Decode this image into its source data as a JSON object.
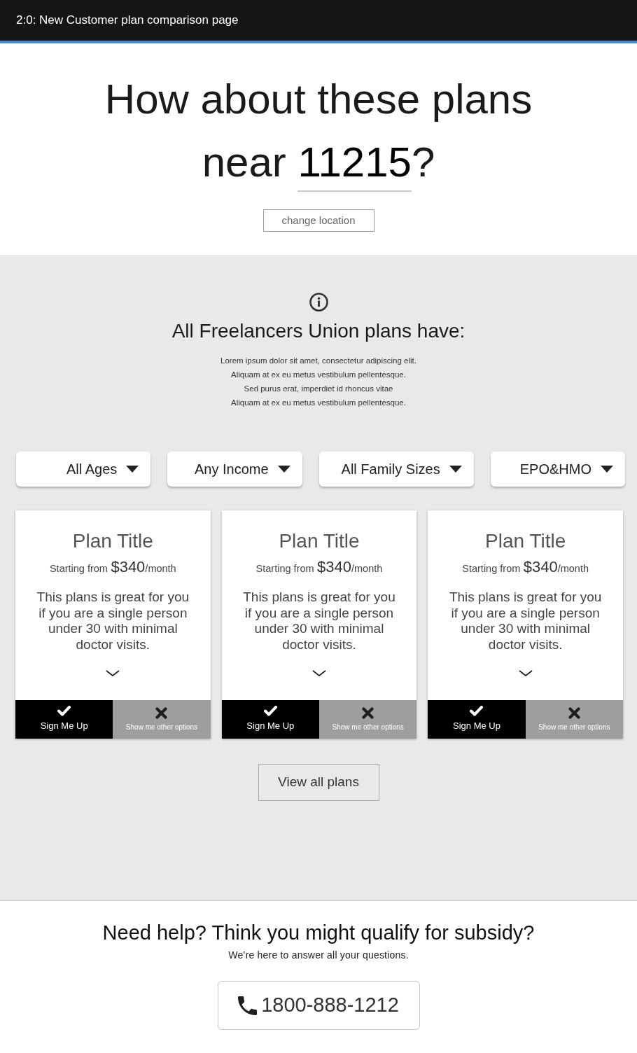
{
  "window": {
    "title": "2:0: New Customer plan comparison page"
  },
  "hero": {
    "heading": "How about these plans near **11215**?",
    "button": "change location"
  },
  "info": {
    "title": "All Freelancers Union plans have:",
    "lines": [
      "Lorem ipsum dolor sit amet, consectetur adipiscing elit.",
      "Aliquam at ex eu metus vestibulum pellentesque.",
      "Sed purus erat, imperdiet id rhoncus vitae",
      "Aliquam at ex eu metus vestibulum pellentesque."
    ]
  },
  "filters": [
    {
      "label": "All Ages"
    },
    {
      "label": "Any Income"
    },
    {
      "label": "All Family Sizes"
    },
    {
      "label": "EPO&HMO"
    }
  ],
  "plans": [
    {
      "title": "Plan Title",
      "price_label": "Starting from",
      "price": "$340",
      "price_period": "/month",
      "description": "This plans is great for you if you are a single person under 30 with minimal doctor visits.",
      "actions": [
        {
          "kind": "accept",
          "label": "Sign Me Up"
        },
        {
          "kind": "decline",
          "label": "Show me other options"
        }
      ]
    },
    {
      "title": "Plan Title",
      "price_label": "Starting from",
      "price": "$340",
      "price_period": "/month",
      "description": "This plans is great for you if you are a single person under 30 with minimal doctor visits.",
      "actions": [
        {
          "kind": "accept",
          "label": "Sign Me Up"
        },
        {
          "kind": "decline",
          "label": "Show me other options"
        }
      ]
    },
    {
      "title": "Plan Title",
      "price_label": "Starting from",
      "price": "$340",
      "price_period": "/month",
      "description": "This plans is great for you if you are a single person under 30 with minimal doctor visits.",
      "actions": [
        {
          "kind": "accept",
          "label": "Sign Me Up"
        },
        {
          "kind": "decline",
          "label": "Show me other options"
        }
      ]
    }
  ],
  "view_all": {
    "label": "View all plans"
  },
  "help": {
    "title": "Need help? Think you might qualify for subsidy?",
    "subtitle": "We’re here to answer all your questions.",
    "phone": "1800-888-1212"
  }
}
